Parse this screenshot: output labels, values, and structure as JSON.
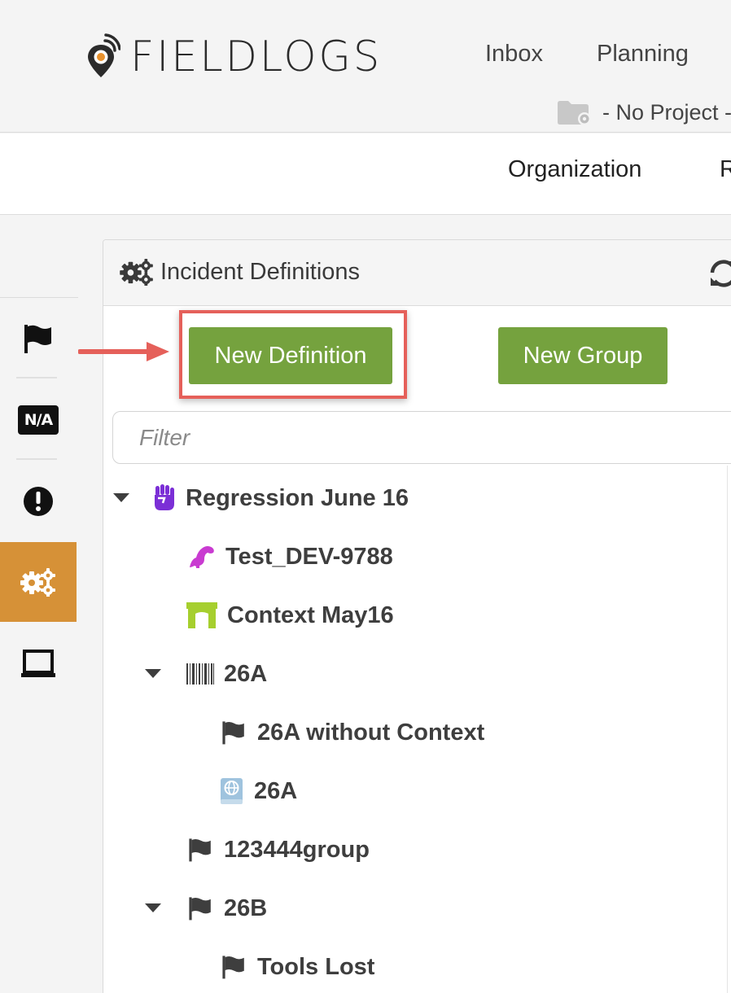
{
  "app": {
    "logo_text": "FIELDLOGS"
  },
  "topnav": {
    "inbox": "Inbox",
    "planning": "Planning"
  },
  "project": {
    "label": "- No Project -"
  },
  "subnav": {
    "organization": "Organization",
    "next_partial": "R"
  },
  "panel": {
    "title": "Incident Definitions"
  },
  "buttons": {
    "new_definition": "New Definition",
    "new_group": "New Group"
  },
  "filter": {
    "placeholder": "Filter",
    "value": ""
  },
  "tree": [
    {
      "label": "Regression June 16",
      "icon": "fist-icon",
      "color": "#7b2fd6",
      "expanded": true
    },
    {
      "label": "Test_DEV-9788",
      "icon": "dinosaur-icon",
      "color": "#c93bd1"
    },
    {
      "label": "Context May16",
      "icon": "arch-icon",
      "color": "#a6cf2e"
    },
    {
      "label": "26A",
      "icon": "barcode-icon",
      "color": "#3e3e3e",
      "expanded": true
    },
    {
      "label": "26A without Context",
      "icon": "flag-icon",
      "color": "#3e3e3e"
    },
    {
      "label": "26A",
      "icon": "globe-book-icon",
      "color": "#9fc3de"
    },
    {
      "label": "123444group",
      "icon": "flag-icon",
      "color": "#3e3e3e"
    },
    {
      "label": "26B",
      "icon": "flag-icon",
      "color": "#3e3e3e",
      "expanded": true
    },
    {
      "label": "Tools Lost",
      "icon": "flag-icon",
      "color": "#3e3e3e"
    }
  ],
  "rail": [
    {
      "icon": "flag-icon"
    },
    {
      "icon": "na-badge-icon",
      "text": "N/A"
    },
    {
      "icon": "alert-icon"
    },
    {
      "icon": "gears-icon",
      "active": true
    },
    {
      "icon": "screen-icon"
    }
  ],
  "colors": {
    "accent_green": "#75a23e",
    "rail_active": "#d69137",
    "annotation_red": "#e5605a",
    "logo_orange": "#e8912d"
  }
}
